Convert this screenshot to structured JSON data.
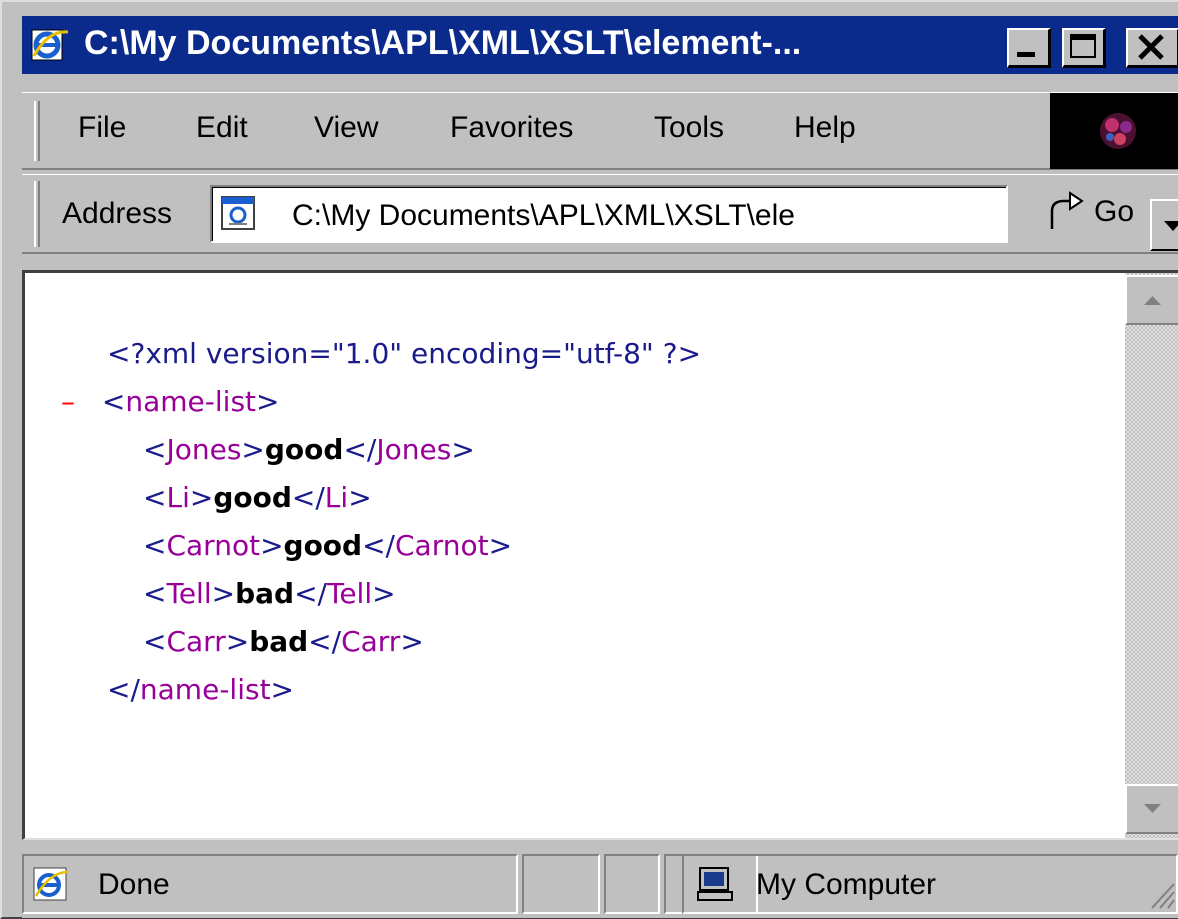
{
  "window": {
    "title": "C:\\My Documents\\APL\\XML\\XSLT\\element-..."
  },
  "menu": {
    "items": [
      {
        "label": "File"
      },
      {
        "label": "Edit"
      },
      {
        "label": "View"
      },
      {
        "label": "Favorites"
      },
      {
        "label": "Tools"
      },
      {
        "label": "Help"
      }
    ]
  },
  "address": {
    "label": "Address",
    "value": "C:\\My Documents\\APL\\XML\\XSLT\\ele",
    "go_label": "Go"
  },
  "document": {
    "xml_declaration": "<?xml version=\"1.0\" encoding=\"utf-8\" ?>",
    "collapse_toggle": "–",
    "root_open": "name-list",
    "root_close": "name-list",
    "children": [
      {
        "tag": "Jones",
        "value": "good"
      },
      {
        "tag": "Li",
        "value": "good"
      },
      {
        "tag": "Carnot",
        "value": "good"
      },
      {
        "tag": "Tell",
        "value": "bad"
      },
      {
        "tag": "Carr",
        "value": "bad"
      }
    ]
  },
  "status": {
    "text": "Done",
    "zone": "My Computer"
  },
  "colors": {
    "titlebar": "#0a2a8c",
    "tag": "#990099",
    "markup": "#1a1a8c",
    "toggle": "#ff0000"
  }
}
